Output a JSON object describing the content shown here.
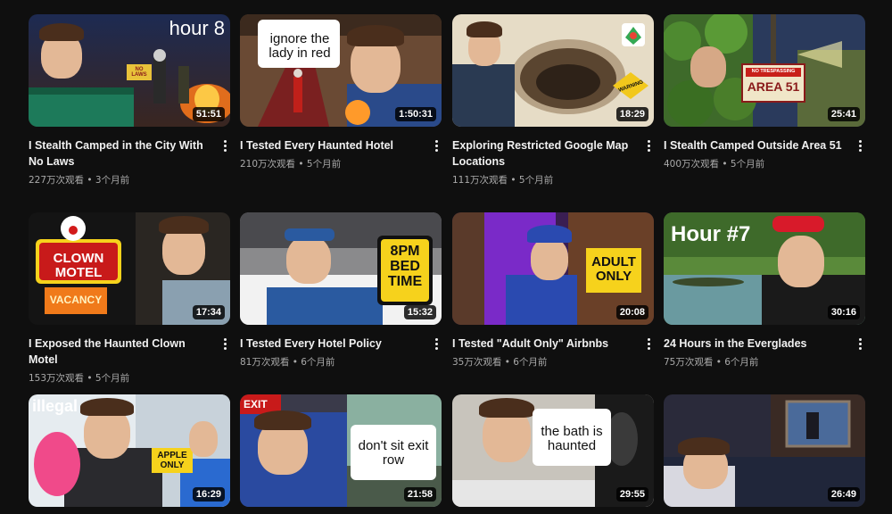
{
  "videos": [
    {
      "title": "I Stealth Camped in the City With No Laws",
      "meta": "227万次观看 • 3个月前",
      "duration": "51:51",
      "overlay": "hour 8",
      "sign": "NO LAWS"
    },
    {
      "title": "I Tested Every Haunted Hotel",
      "meta": "210万次观看 • 5个月前",
      "duration": "1:50:31",
      "overlay": "ignore the lady in red"
    },
    {
      "title": "Exploring Restricted Google Map Locations",
      "meta": "111万次观看 • 5个月前",
      "duration": "18:29",
      "overlay": "WARNING"
    },
    {
      "title": "I Stealth Camped Outside Area 51",
      "meta": "400万次观看 • 5个月前",
      "duration": "25:41",
      "overlay": "AREA 51",
      "sign": "NO TRESPASSING"
    },
    {
      "title": "I Exposed the Haunted Clown Motel",
      "meta": "153万次观看 • 5个月前",
      "duration": "17:34",
      "overlay": "CLOWN MOTEL",
      "sign": "VACANCY"
    },
    {
      "title": "I Tested Every Hotel Policy",
      "meta": "81万次观看 • 6个月前",
      "duration": "15:32",
      "overlay": "8PM BED TIME"
    },
    {
      "title": "I Tested \"Adult Only\" Airbnbs",
      "meta": "35万次观看 • 6个月前",
      "duration": "20:08",
      "overlay": "ADULT ONLY"
    },
    {
      "title": "24 Hours in the Everglades",
      "meta": "75万次观看 • 6个月前",
      "duration": "30:16",
      "overlay": "Hour #7"
    },
    {
      "title": "",
      "meta": "",
      "duration": "16:29",
      "overlay": "illegal",
      "sign": "APPLE ONLY"
    },
    {
      "title": "",
      "meta": "",
      "duration": "21:58",
      "overlay": "don't sit exit row",
      "sign": "EXIT"
    },
    {
      "title": "",
      "meta": "",
      "duration": "29:55",
      "overlay": "the bath is haunted"
    },
    {
      "title": "",
      "meta": "",
      "duration": "26:49",
      "overlay": ""
    }
  ]
}
